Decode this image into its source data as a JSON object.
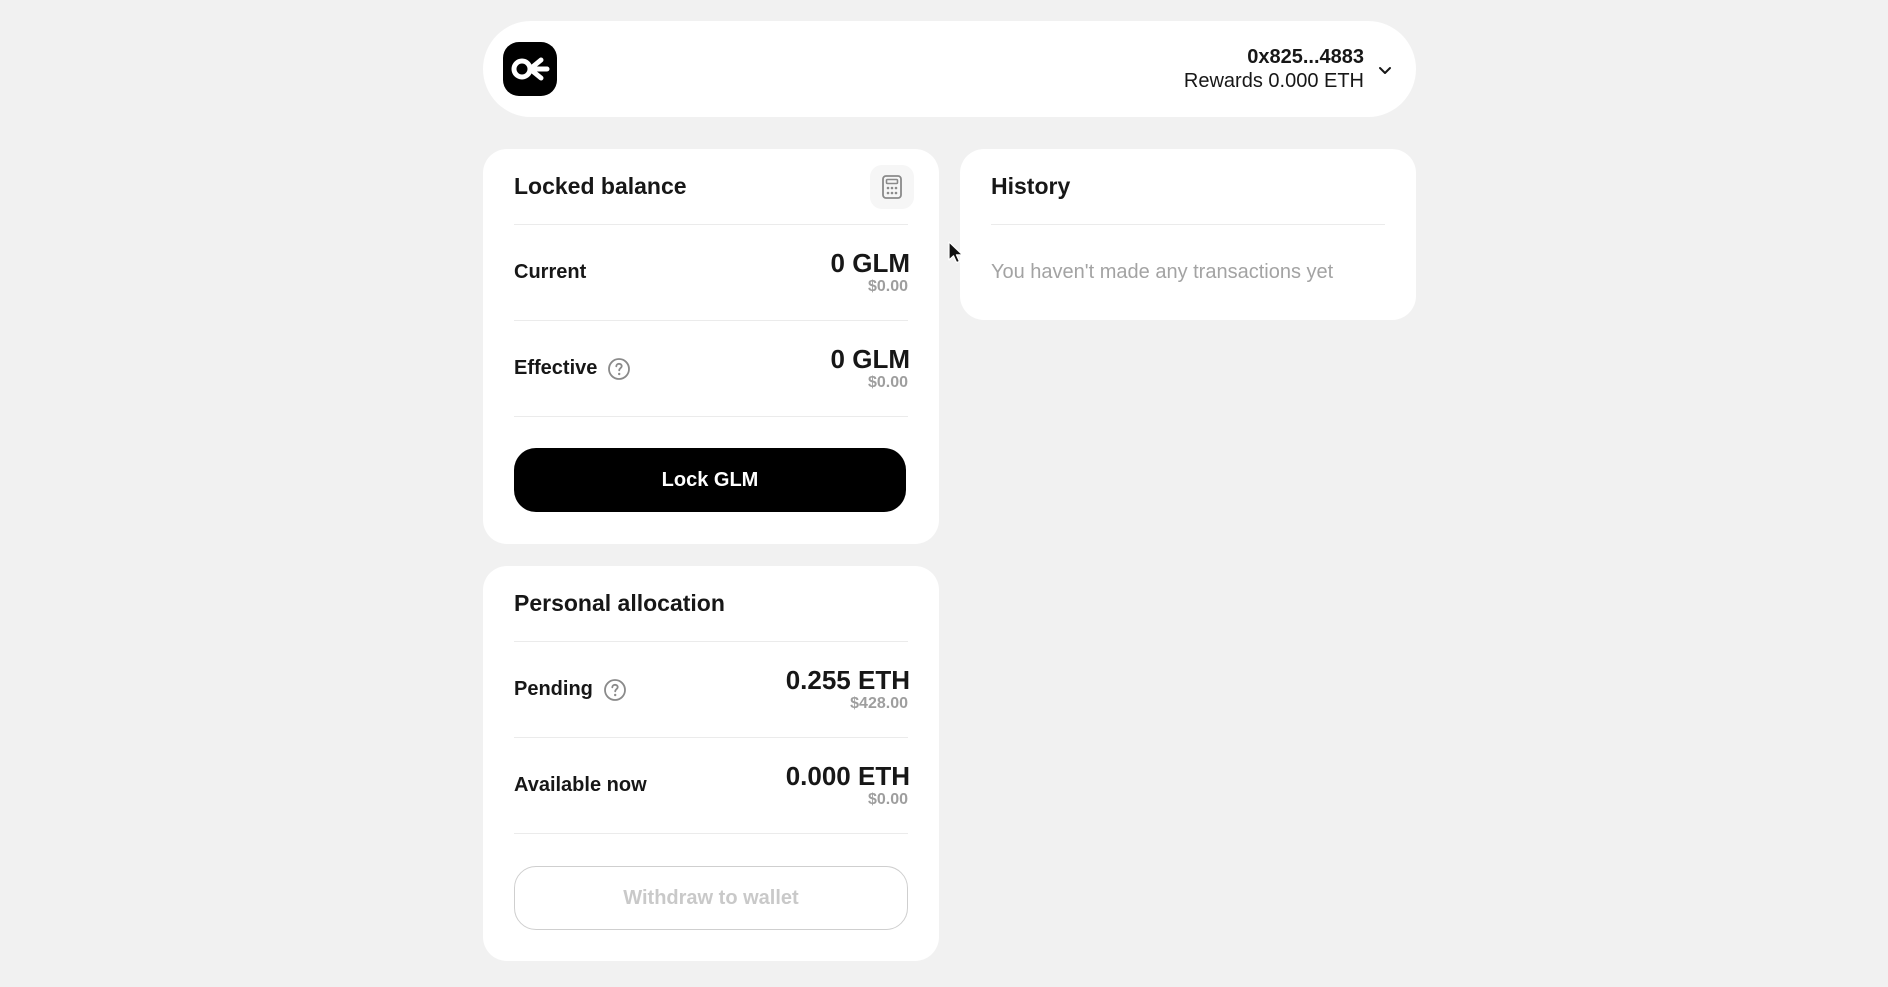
{
  "header": {
    "logo_icon": "octant-logo-icon",
    "address": "0x825...4883",
    "rewards": "Rewards 0.000 ETH",
    "menu_icon": "chevron-down-icon"
  },
  "locked_balance": {
    "title": "Locked balance",
    "calculator_icon": "calculator-icon",
    "current": {
      "label": "Current",
      "value": "0 GLM",
      "fiat": "$0.00"
    },
    "effective": {
      "label": "Effective",
      "value": "0 GLM",
      "fiat": "$0.00",
      "help_icon": "question-circle-icon"
    },
    "lock_button": "Lock GLM"
  },
  "personal_allocation": {
    "title": "Personal allocation",
    "pending": {
      "label": "Pending",
      "value": "0.255 ETH",
      "fiat": "$428.00",
      "help_icon": "question-circle-icon"
    },
    "available": {
      "label": "Available now",
      "value": "0.000 ETH",
      "fiat": "$0.00"
    },
    "withdraw_button": "Withdraw to wallet"
  },
  "history": {
    "title": "History",
    "empty_message": "You haven't made any transactions yet"
  },
  "colors": {
    "background": "#f1f1f1",
    "card": "#ffffff",
    "primary_button": "#000000",
    "muted_text": "#9e9e9e",
    "divider": "#ebebeb"
  }
}
